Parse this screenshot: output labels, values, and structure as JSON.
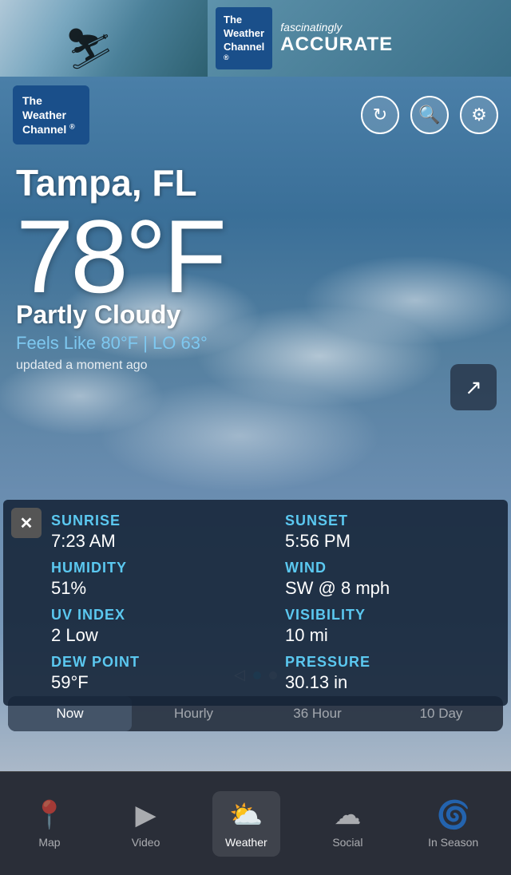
{
  "ad": {
    "logo_line1": "The",
    "logo_line2": "Weather",
    "logo_line3": "Channel",
    "tagline_small": "fascinatingly",
    "tagline_large": "ACCURATE"
  },
  "header": {
    "logo_line1": "The",
    "logo_line2": "Weather",
    "logo_line3": "Channel",
    "icon_refresh": "↻",
    "icon_search": "🔍",
    "icon_settings": "⚙"
  },
  "weather": {
    "city": "Tampa, FL",
    "temperature": "78°F",
    "condition": "Partly Cloudy",
    "feels_like": "Feels Like 80°F  |  LO 63°",
    "updated": "updated a moment ago"
  },
  "details": {
    "close_icon": "✕",
    "items": [
      {
        "label": "SUNRISE",
        "value": "7:23 AM"
      },
      {
        "label": "SUNSET",
        "value": "5:56 PM"
      },
      {
        "label": "HUMIDITY",
        "value": "51%"
      },
      {
        "label": "WIND",
        "value": "SW @ 8 mph"
      },
      {
        "label": "UV INDEX",
        "value": "2 Low"
      },
      {
        "label": "VISIBILITY",
        "value": "10 mi"
      },
      {
        "label": "DEW POINT",
        "value": "59°F"
      },
      {
        "label": "PRESSURE",
        "value": "30.13 in"
      }
    ]
  },
  "tabs": [
    {
      "label": "Now",
      "active": true
    },
    {
      "label": "Hourly",
      "active": false
    },
    {
      "label": "36 Hour",
      "active": false
    },
    {
      "label": "10 Day",
      "active": false
    }
  ],
  "bottom_nav": [
    {
      "label": "Map",
      "icon": "📍",
      "active": false
    },
    {
      "label": "Video",
      "icon": "▶",
      "active": false
    },
    {
      "label": "Weather",
      "icon": "⛅",
      "active": true
    },
    {
      "label": "Social",
      "icon": "☁",
      "active": false
    },
    {
      "label": "In Season",
      "icon": "🌀",
      "active": false
    }
  ],
  "share_icon": "↗"
}
